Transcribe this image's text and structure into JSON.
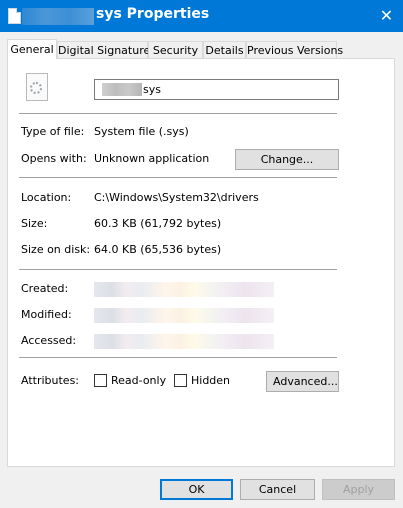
{
  "window": {
    "title": "sys Properties",
    "close_glyph": "✕"
  },
  "tabs": [
    {
      "label": "General",
      "active": true
    },
    {
      "label": "Digital Signatures"
    },
    {
      "label": "Security"
    },
    {
      "label": "Details"
    },
    {
      "label": "Previous Versions"
    }
  ],
  "general": {
    "file_name": "sys",
    "type_label": "Type of file:",
    "type_value": "System file (.sys)",
    "opens_label": "Opens with:",
    "opens_value": "Unknown application",
    "change_button": "Change...",
    "location_label": "Location:",
    "location_value": "C:\\Windows\\System32\\drivers",
    "size_label": "Size:",
    "size_value": "60.3 KB (61,792 bytes)",
    "size_on_disk_label": "Size on disk:",
    "size_on_disk_value": "64.0 KB (65,536 bytes)",
    "created_label": "Created:",
    "modified_label": "Modified:",
    "accessed_label": "Accessed:",
    "attributes_label": "Attributes:",
    "readonly_label": "Read-only",
    "readonly_checked": false,
    "hidden_label": "Hidden",
    "hidden_checked": false,
    "advanced_button": "Advanced..."
  },
  "footer": {
    "ok": "OK",
    "cancel": "Cancel",
    "apply": "Apply"
  },
  "colors": {
    "titlebar": "#0078d7",
    "accent": "#0078d7"
  }
}
